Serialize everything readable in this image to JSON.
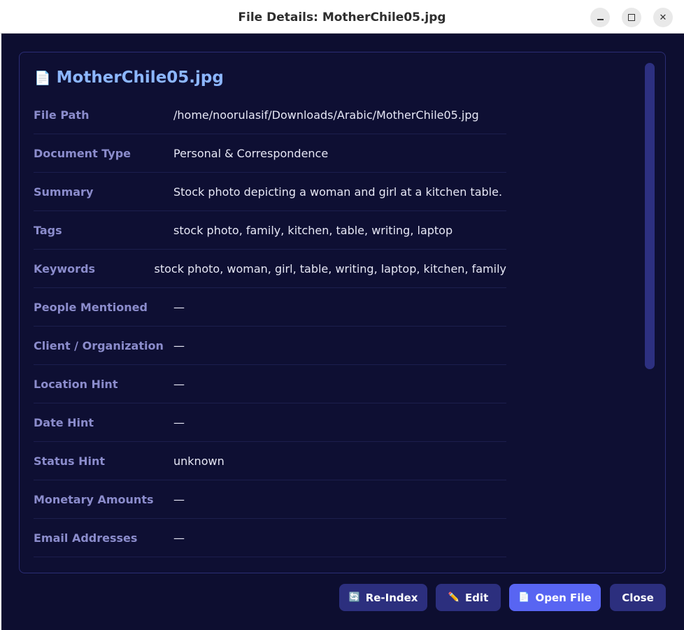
{
  "window": {
    "title": "File Details: MotherChile05.jpg"
  },
  "header": {
    "icon": "document-icon",
    "file_name": "MotherChile05.jpg"
  },
  "fields": [
    {
      "label": "File Path",
      "value": "/home/noorulasif/Downloads/Arabic/MotherChile05.jpg"
    },
    {
      "label": "Document Type",
      "value": "Personal & Correspondence"
    },
    {
      "label": "Summary",
      "value": "Stock photo depicting a woman and girl at a kitchen table."
    },
    {
      "label": "Tags",
      "value": "stock photo, family, kitchen, table, writing, laptop"
    },
    {
      "label": "Keywords",
      "value": "stock photo, woman, girl, table, writing, laptop, kitchen, family"
    },
    {
      "label": "People Mentioned",
      "value": "—"
    },
    {
      "label": "Client / Organization",
      "value": "—"
    },
    {
      "label": "Location Hint",
      "value": "—"
    },
    {
      "label": "Date Hint",
      "value": "—"
    },
    {
      "label": "Status Hint",
      "value": "unknown"
    },
    {
      "label": "Monetary Amounts",
      "value": "—"
    },
    {
      "label": "Email Addresses",
      "value": "—"
    }
  ],
  "actions": {
    "reindex_label": "Re-Index",
    "edit_label": "Edit",
    "open_label": "Open File",
    "close_label": "Close"
  },
  "colors": {
    "background": "#0d0e30",
    "accent": "#5865f2",
    "title_color": "#8cb6ff",
    "label_color": "#8b8ccc"
  }
}
